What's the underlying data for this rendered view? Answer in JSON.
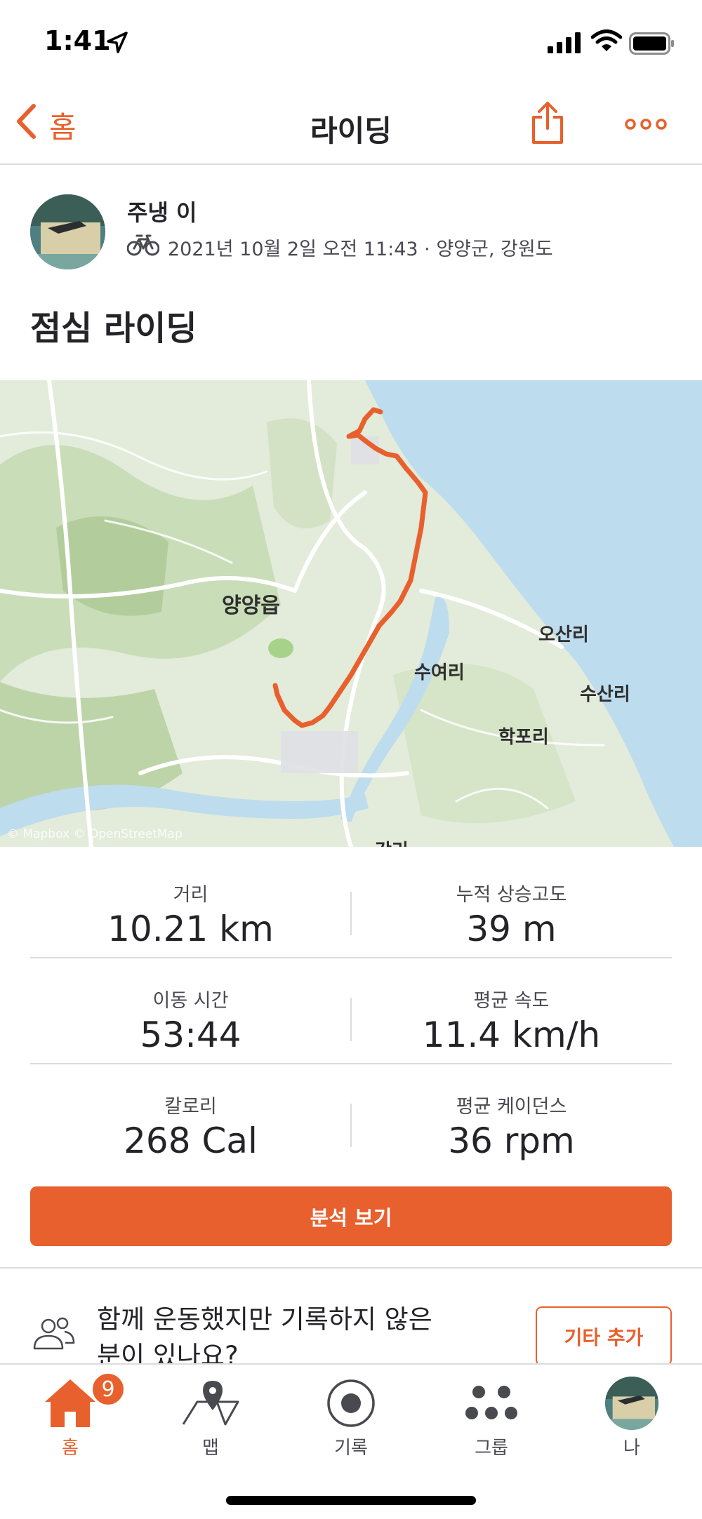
{
  "status_bar": {
    "time": "1:41"
  },
  "nav": {
    "back_label": "홈",
    "title": "라이딩"
  },
  "activity": {
    "athlete_name": "주냉 이",
    "meta": "2021년 10월 2일 오전 11:43 · 양양군, 강원도",
    "title": "점심 라이딩"
  },
  "map": {
    "labels": {
      "town": "양양읍",
      "suyeo": "수여리",
      "osan": "오산리",
      "susan": "수산리",
      "hakpo": "학포리",
      "bottom": "강리"
    },
    "attribution": "© Mapbox © OpenStreetMap",
    "route_color": "#e8602d"
  },
  "stats": [
    {
      "label": "거리",
      "value": "10.21 km"
    },
    {
      "label": "누적 상승고도",
      "value": "39 m"
    },
    {
      "label": "이동 시간",
      "value": "53:44"
    },
    {
      "label": "평균 속도",
      "value": "11.4 km/h"
    },
    {
      "label": "칼로리",
      "value": "268 Cal"
    },
    {
      "label": "평균 케이던스",
      "value": "36 rpm"
    }
  ],
  "analysis_button": "분석 보기",
  "invite": {
    "text": "함께 운동했지만 기록하지 않은 분이 있나요?",
    "button": "기타 추가"
  },
  "tabs": [
    {
      "label": "홈",
      "icon": "home-icon",
      "badge": "9"
    },
    {
      "label": "맵",
      "icon": "map-icon"
    },
    {
      "label": "기록",
      "icon": "record-icon"
    },
    {
      "label": "그룹",
      "icon": "groups-icon"
    },
    {
      "label": "나",
      "icon": "profile-icon"
    }
  ],
  "colors": {
    "accent": "#e8602d",
    "water": "#bddcee",
    "land": "#e3ebdb"
  }
}
